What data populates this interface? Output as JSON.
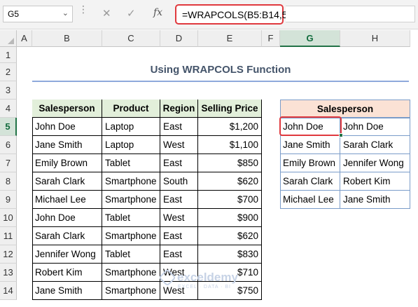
{
  "formula_bar": {
    "name_box": "G5",
    "cancel_icon": "✕",
    "enter_icon": "✓",
    "fx_label": "fx",
    "formula": "=WRAPCOLS(B5:B14,5)"
  },
  "columns": [
    "A",
    "B",
    "C",
    "D",
    "E",
    "F",
    "G",
    "H"
  ],
  "rows": [
    "1",
    "2",
    "3",
    "4",
    "5",
    "6",
    "7",
    "8",
    "9",
    "10",
    "11",
    "12",
    "13",
    "14"
  ],
  "selected_cell": "G5",
  "title": "Using WRAPCOLS Function",
  "source_table": {
    "headers": [
      "Salesperson",
      "Product",
      "Region",
      "Selling Price"
    ],
    "rows": [
      [
        "John Doe",
        "Laptop",
        "East",
        "$1,200"
      ],
      [
        "Jane Smith",
        "Laptop",
        "West",
        "$1,100"
      ],
      [
        "Emily Brown",
        "Tablet",
        "East",
        "$850"
      ],
      [
        "Sarah Clark",
        "Smartphone",
        "South",
        "$620"
      ],
      [
        "Michael Lee",
        "Smartphone",
        "East",
        "$700"
      ],
      [
        "John Doe",
        "Tablet",
        "West",
        "$900"
      ],
      [
        "Sarah Clark",
        "Smartphone",
        "East",
        "$620"
      ],
      [
        "Jennifer Wong",
        "Tablet",
        "East",
        "$830"
      ],
      [
        "Robert Kim",
        "Smartphone",
        "West",
        "$710"
      ],
      [
        "Jane Smith",
        "Smartphone",
        "West",
        "$750"
      ]
    ]
  },
  "output_table": {
    "header": "Salesperson",
    "rows": [
      [
        "John Doe",
        "John Doe"
      ],
      [
        "Jane Smith",
        "Sarah Clark"
      ],
      [
        "Emily Brown",
        "Jennifer Wong"
      ],
      [
        "Sarah Clark",
        "Robert Kim"
      ],
      [
        "Michael Lee",
        "Jane Smith"
      ]
    ]
  },
  "watermark": {
    "name": "exceldemy",
    "tagline": "EXCEL · DATA · BI"
  },
  "colors": {
    "accent_red": "#e0393e",
    "header_green": "#e2efda",
    "header_peach": "#fbe2d5",
    "excel_green": "#217346"
  }
}
